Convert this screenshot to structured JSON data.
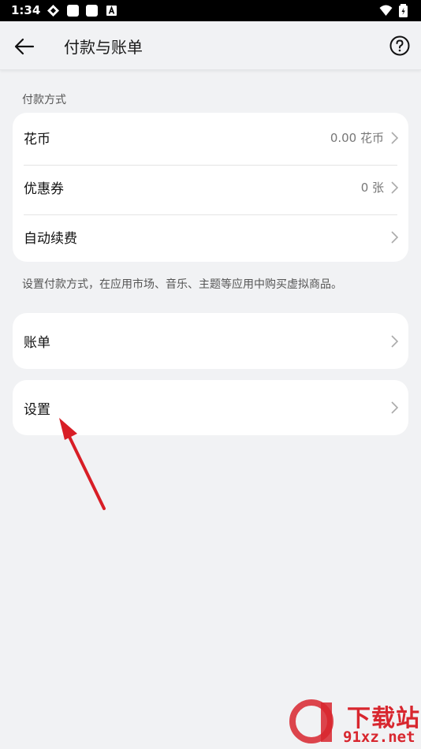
{
  "status_bar": {
    "time": "1:34"
  },
  "header": {
    "title": "付款与账单"
  },
  "payment_methods": {
    "section_label": "付款方式",
    "items": [
      {
        "label": "花币",
        "value": "0.00 花币"
      },
      {
        "label": "优惠券",
        "value": "0 张"
      },
      {
        "label": "自动续费",
        "value": ""
      }
    ],
    "hint": "设置付款方式，在应用市场、音乐、主题等应用中购买虚拟商品。"
  },
  "bills": {
    "label": "账单"
  },
  "settings": {
    "label": "设置"
  },
  "watermark": {
    "brand": "下载站",
    "domain": "91xz.net"
  },
  "colors": {
    "background": "#f1f2f4",
    "card": "#ffffff",
    "annotation_arrow": "#d81e26",
    "watermark": "#d8262e"
  }
}
